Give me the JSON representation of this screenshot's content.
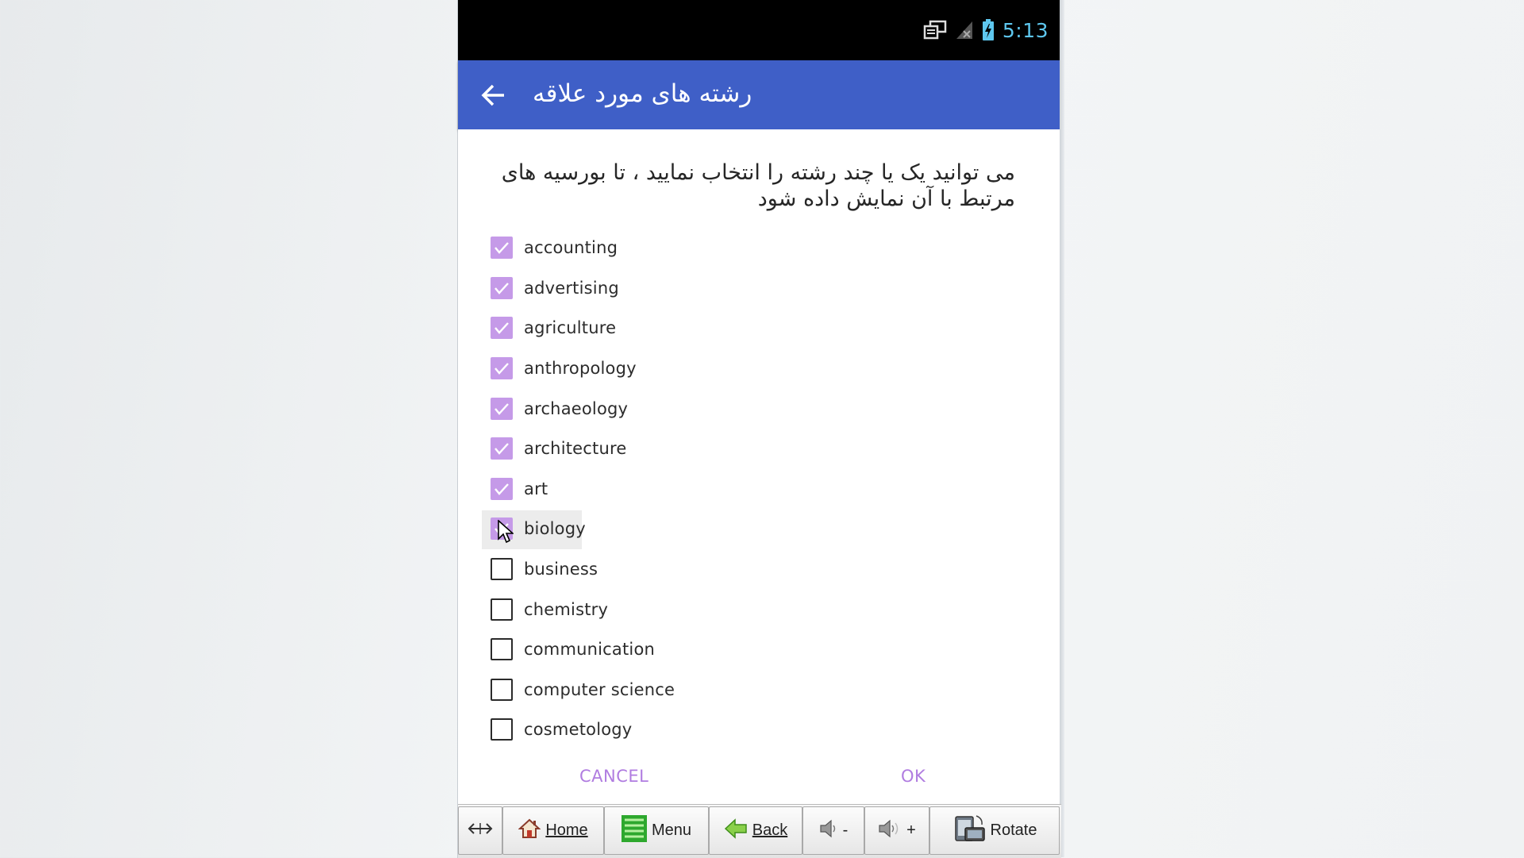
{
  "statusbar": {
    "time": "5:13",
    "icons": [
      "screen-cast-icon",
      "no-signal-icon",
      "battery-charging-icon"
    ],
    "time_color": "#5ec7ef"
  },
  "appbar": {
    "title": "رشته های مورد علاقه",
    "back_icon": "back-arrow-icon",
    "color": "#3f5fc7"
  },
  "dialog": {
    "message_line1": "می توانید یک یا چند رشته را انتخاب نمایید ، تا بورسیه های",
    "message_line2": "مرتبط با آن نمایش داده شود",
    "options": [
      {
        "label": "accounting",
        "checked": true
      },
      {
        "label": "advertising",
        "checked": true
      },
      {
        "label": "agriculture",
        "checked": true
      },
      {
        "label": "anthropology",
        "checked": true
      },
      {
        "label": "archaeology",
        "checked": true
      },
      {
        "label": "architecture",
        "checked": true
      },
      {
        "label": "art",
        "checked": true
      },
      {
        "label": "biology",
        "checked": true,
        "pressed": true
      },
      {
        "label": "business",
        "checked": false
      },
      {
        "label": "chemistry",
        "checked": false
      },
      {
        "label": "communication",
        "checked": false
      },
      {
        "label": "computer science",
        "checked": false
      },
      {
        "label": "cosmetology",
        "checked": false
      }
    ],
    "cancel_label": "CANCEL",
    "ok_label": "OK",
    "check_color": "#c59ae8",
    "accent_color": "#b07ce0"
  },
  "toolbar": {
    "home_label": "Home",
    "menu_label": "Menu",
    "back_label": "Back",
    "vol_down_label": "-",
    "vol_up_label": "+",
    "rotate_label": "Rotate"
  }
}
